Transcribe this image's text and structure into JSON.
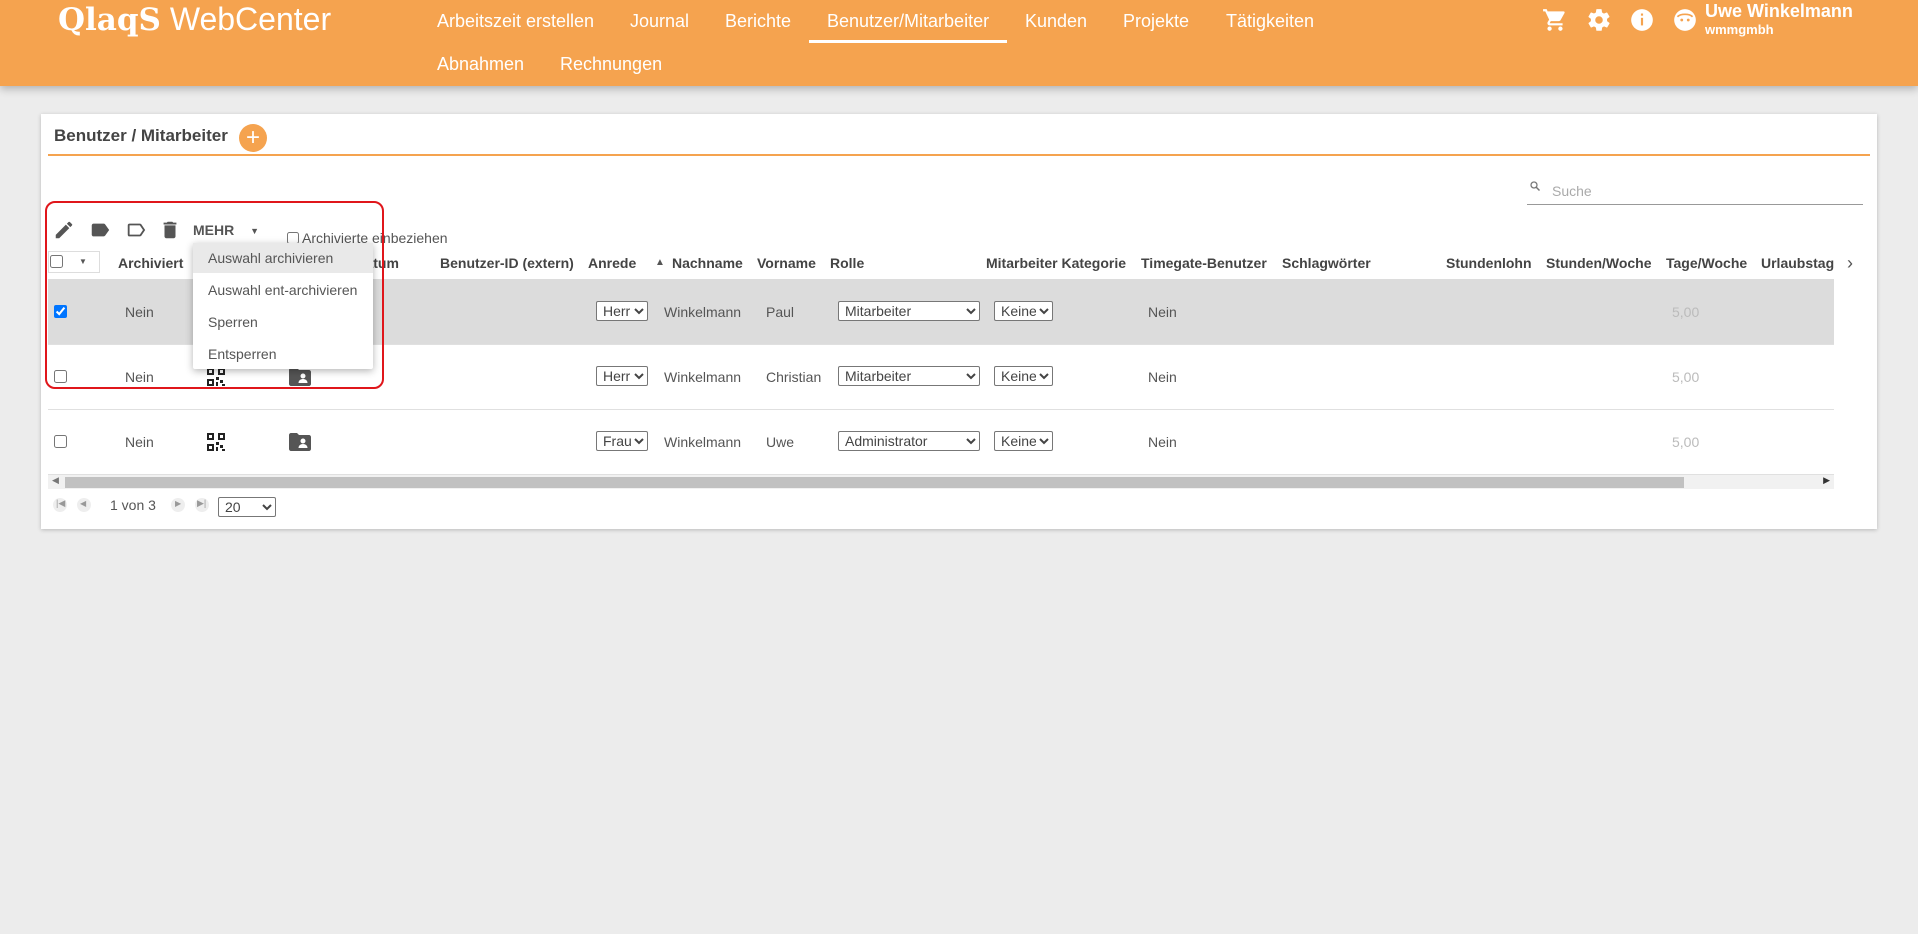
{
  "header": {
    "logo_brand": "QlaqS",
    "logo_suffix": " WebCenter",
    "nav": [
      "Arbeitszeit erstellen",
      "Journal",
      "Berichte",
      "Benutzer/Mitarbeiter",
      "Kunden",
      "Projekte",
      "Tätigkeiten",
      "Abnahmen",
      "Rechnungen"
    ],
    "active_nav": "Benutzer/Mitarbeiter",
    "icons": [
      "cart-icon",
      "gear-icon",
      "info-icon",
      "avatar-icon"
    ],
    "user": {
      "name": "Uwe Winkelmann",
      "org": "wmmgmbh"
    }
  },
  "panel": {
    "title": "Benutzer / Mitarbeiter",
    "add_symbol": "+",
    "search": {
      "placeholder": "Suche",
      "value": ""
    },
    "toolbar": {
      "icons": [
        "pencil-icon",
        "tag-filled-icon",
        "tag-outline-icon",
        "trash-icon"
      ],
      "more_label": "MEHR",
      "include_archived_label": "Archivierte einbeziehen"
    },
    "columns": [
      "Archiviert",
      "rrdatum",
      "Benutzer-ID (extern)",
      "Anrede",
      "Nachname",
      "Vorname",
      "Rolle",
      "Mitarbeiter Kategorie",
      "Timegate-Benutzer",
      "Schlagwörter",
      "Stundenlohn",
      "Stunden/Woche",
      "Tage/Woche",
      "Urlaubstag"
    ],
    "sort_column": "Nachname",
    "rows": [
      {
        "checked": true,
        "archiviert": "Nein",
        "anrede": "Herr",
        "nachname": "Winkelmann",
        "vorname": "Paul",
        "rolle": "Mitarbeiter",
        "kategorie": "Keine",
        "timegate": "Nein",
        "tage_woche": "5,00"
      },
      {
        "checked": false,
        "archiviert": "Nein",
        "anrede": "Herr",
        "nachname": "Winkelmann",
        "vorname": "Christian",
        "rolle": "Mitarbeiter",
        "kategorie": "Keine",
        "timegate": "Nein",
        "tage_woche": "5,00"
      },
      {
        "checked": false,
        "archiviert": "Nein",
        "anrede": "Frau",
        "nachname": "Winkelmann",
        "vorname": "Uwe",
        "rolle": "Administrator",
        "kategorie": "Keine",
        "timegate": "Nein",
        "tage_woche": "5,00"
      }
    ],
    "pagination": {
      "label": "1 von 3",
      "page_size": "20"
    },
    "more_menu": [
      "Auswahl archivieren",
      "Auswahl ent-archivieren",
      "Sperren",
      "Entsperren"
    ]
  },
  "colors": {
    "brand": "#f5a34f",
    "highlight": "#e0161b"
  }
}
